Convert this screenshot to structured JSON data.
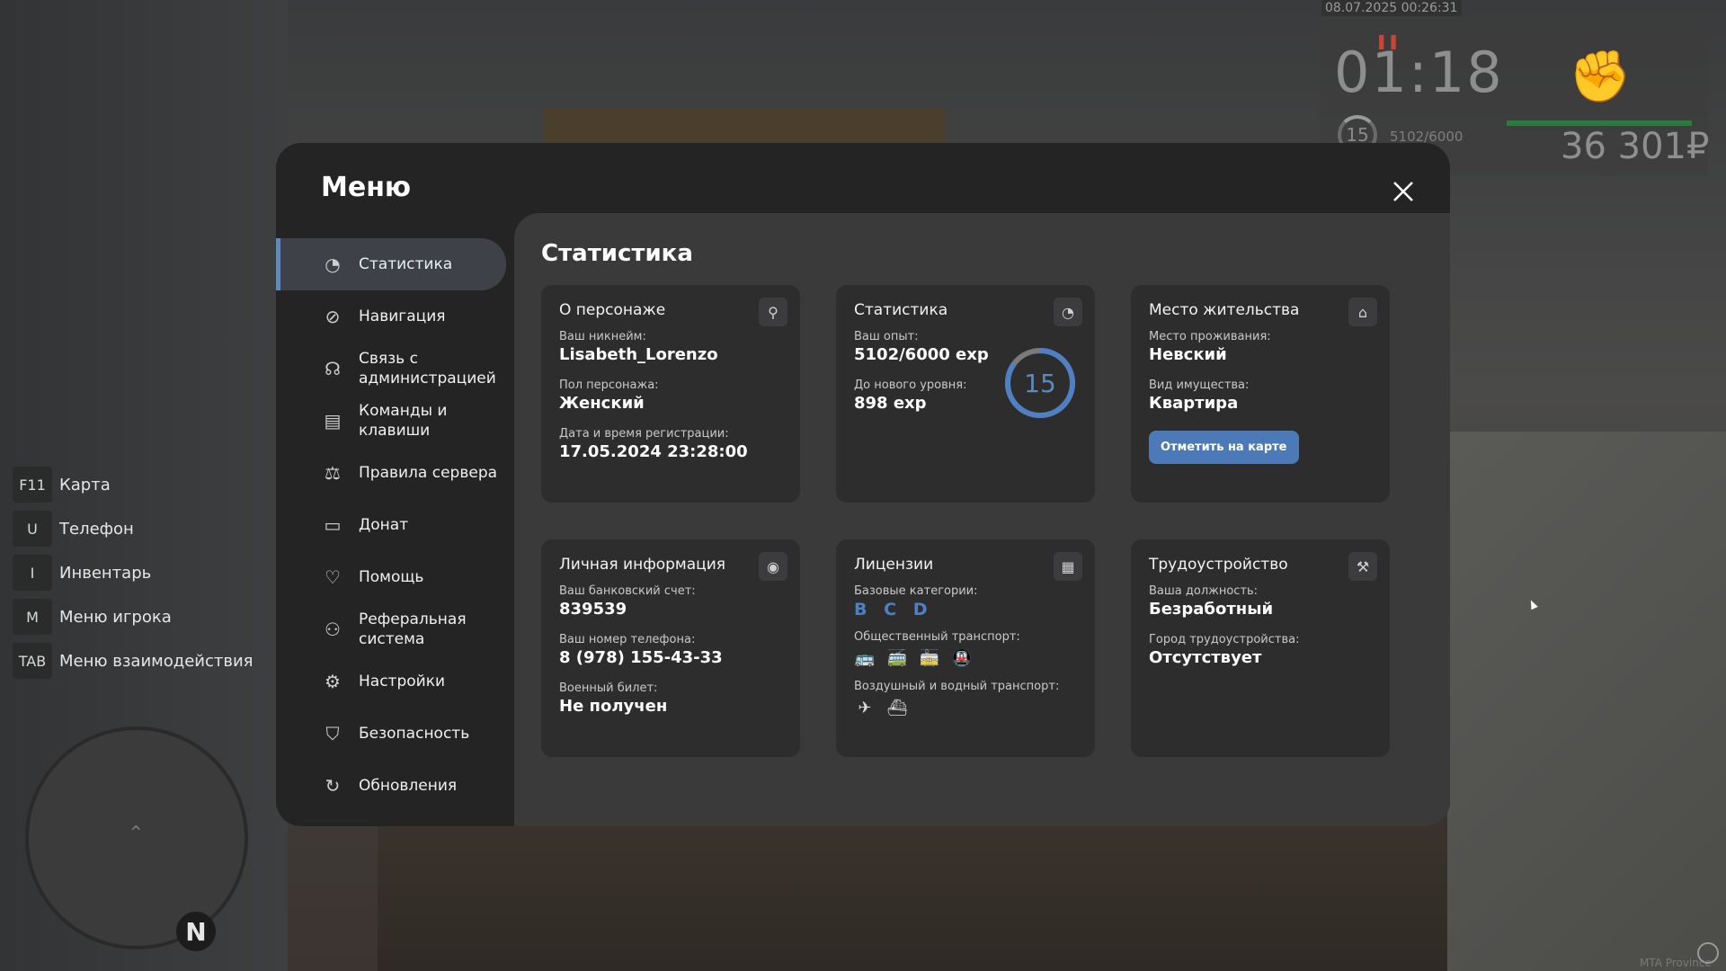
{
  "hud": {
    "datetime": "08.07.2025 00:26:31",
    "time": "01:18",
    "level": "15",
    "exp": "5102/6000",
    "money": "36 301₽"
  },
  "keys": [
    {
      "key": "F11",
      "label": "Карта"
    },
    {
      "key": "U",
      "label": "Телефон"
    },
    {
      "key": "I",
      "label": "Инвентарь"
    },
    {
      "key": "M",
      "label": "Меню игрока"
    },
    {
      "key": "TAB",
      "label": "Меню взаимодействия"
    }
  ],
  "minimap": {
    "north": "N"
  },
  "watermark": "MTA Province",
  "menu": {
    "title": "Меню",
    "sidebar": [
      {
        "label": "Статистика",
        "icon": "pie-chart-icon"
      },
      {
        "label": "Навигация",
        "icon": "compass-icon"
      },
      {
        "label": "Связь с администрацией",
        "icon": "headset-icon"
      },
      {
        "label": "Команды и клавиши",
        "icon": "document-icon"
      },
      {
        "label": "Правила сервера",
        "icon": "scales-icon"
      },
      {
        "label": "Донат",
        "icon": "wallet-icon"
      },
      {
        "label": "Помощь",
        "icon": "handshake-icon"
      },
      {
        "label": "Реферальная система",
        "icon": "referral-icon"
      },
      {
        "label": "Настройки",
        "icon": "gear-icon"
      },
      {
        "label": "Безопасность",
        "icon": "shield-icon"
      },
      {
        "label": "Обновления",
        "icon": "refresh-icon"
      }
    ],
    "active_index": 0,
    "content_title": "Статистика"
  },
  "cards": {
    "character": {
      "title": "О персонаже",
      "nick_label": "Ваш никнейм:",
      "nick": "Lisabeth_Lorenzo",
      "gender_label": "Пол персонажа:",
      "gender": "Женский",
      "reg_label": "Дата и время регистрации:",
      "reg": "17.05.2024 23:28:00"
    },
    "stats": {
      "title": "Статистика",
      "exp_label": "Ваш опыт:",
      "exp": "5102/6000 exp",
      "next_label": "До нового уровня:",
      "next": "898 exp",
      "level": "15",
      "progress": 0.8503
    },
    "residence": {
      "title": "Место жительства",
      "place_label": "Место проживания:",
      "place": "Невский",
      "type_label": "Вид имущества:",
      "type": "Квартира",
      "button": "Отметить на карте"
    },
    "personal": {
      "title": "Личная информация",
      "bank_label": "Ваш банковский счет:",
      "bank": "839539",
      "phone_label": "Ваш номер телефона:",
      "phone": "8 (978) 155-43-33",
      "military_label": "Военный билет:",
      "military": "Не получен"
    },
    "licenses": {
      "title": "Лицензии",
      "base_label": "Базовые категории:",
      "base": [
        "B",
        "C",
        "D"
      ],
      "public_label": "Общественный транспорт:",
      "public_icons": [
        "bus-icon",
        "trolleybus-icon",
        "tram-icon",
        "metro-icon"
      ],
      "public_active": [
        false,
        true,
        false,
        false
      ],
      "air_label": "Воздушный и водный транспорт:",
      "air_icons": [
        "plane-icon",
        "boat-icon"
      ]
    },
    "job": {
      "title": "Трудоустройство",
      "position_label": "Ваша должность:",
      "position": "Безработный",
      "city_label": "Город трудоустройства:",
      "city": "Отсутствует"
    }
  },
  "colors": {
    "accent": "#5b89c2",
    "button": "#4c7ab8",
    "panel": "#242424",
    "content": "#3a3a3b",
    "card": "#2d2d2e"
  }
}
